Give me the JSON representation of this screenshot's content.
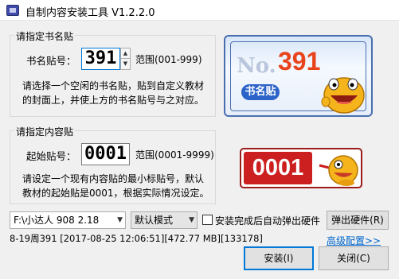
{
  "window": {
    "title": "自制内容安装工具 V1.2.2.0"
  },
  "book_group": {
    "label": "请指定书名贴",
    "field_label": "书名贴号：",
    "value": "391",
    "range": "范围(001-999)",
    "desc_line1": "请选择一个空闲的书名贴，贴到自定义教材",
    "desc_line2": "的封面上，并使上方的书名贴号与之对应。"
  },
  "content_group": {
    "label": "请指定内容贴",
    "field_label": "起始贴号：",
    "value": "0001",
    "range": "范围(0001-9999)",
    "desc_line1": "请设定一个现有内容贴的最小标贴号，默认",
    "desc_line2": "教材的起始贴是0001，根据实际情况设定。"
  },
  "book_preview": {
    "no_label": "No.",
    "number": "391",
    "tag": "书名贴"
  },
  "start_preview": {
    "number": "0001"
  },
  "bottom": {
    "drive_select": "F:\\小达人 908 2.18",
    "mode_select": "默认模式",
    "auto_eject_label": "安装完成后自动弹出硬件",
    "eject_button": "弹出硬件(R)",
    "status": "8-19周391 [2017-08-25 12:06:51][472.77 MB][133178]",
    "advanced_link": "高级配置>>",
    "install_button": "安装(I)",
    "close_button": "关闭(C)"
  },
  "colors": {
    "accent": "#0078d7",
    "brand_red": "#cc1f1f",
    "number_orange": "#e8441c",
    "tag_blue": "#2c63c9"
  }
}
